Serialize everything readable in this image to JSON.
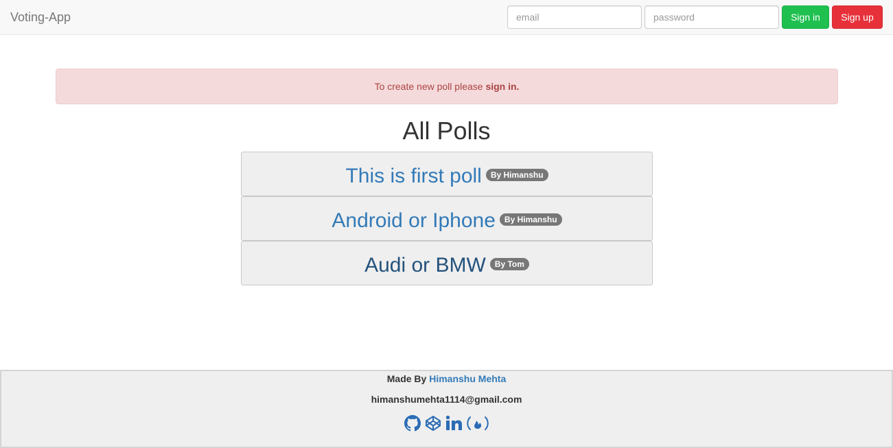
{
  "navbar": {
    "brand": "Voting-App",
    "email_placeholder": "email",
    "password_placeholder": "password",
    "signin_label": "Sign in",
    "signup_label": "Sign up"
  },
  "alert": {
    "text": "To create new poll please ",
    "link_text": "sign in."
  },
  "main": {
    "title": "All Polls",
    "polls": [
      {
        "title": "This is first poll",
        "author": "By Himanshu"
      },
      {
        "title": "Android or Iphone",
        "author": "By Himanshu"
      },
      {
        "title": "Audi or BMW",
        "author": "By Tom"
      }
    ]
  },
  "footer": {
    "made_by": "Made By ",
    "author_name": "Himanshu Mehta",
    "email": "himanshumehta1114@gmail.com",
    "social_icons": [
      "github-icon",
      "codepen-icon",
      "linkedin-icon",
      "freecodecamp-icon"
    ]
  },
  "colors": {
    "signin": "#1fc04f",
    "signup": "#e7313a",
    "link": "#337ab7",
    "alert_bg": "#f5dadb",
    "alert_text": "#a94442"
  }
}
